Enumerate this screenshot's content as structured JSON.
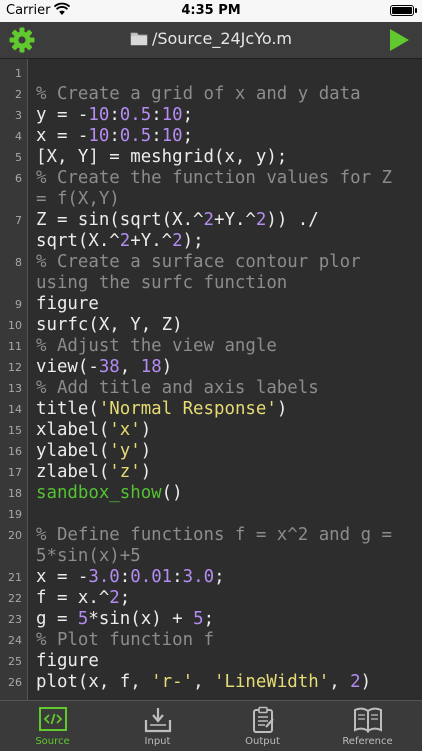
{
  "status_bar": {
    "carrier": "Carrier",
    "time": "4:35 PM"
  },
  "nav": {
    "title": "/Source_24JcYo.m",
    "left_icon": "gear-icon",
    "right_icon": "play-icon",
    "folder_icon": "folder-icon"
  },
  "editor": {
    "lines": [
      {
        "num": "1",
        "rows": 1,
        "tokens": []
      },
      {
        "num": "2",
        "rows": 1,
        "tokens": [
          {
            "t": "% Create a grid of x and y data",
            "k": "c"
          }
        ]
      },
      {
        "num": "3",
        "rows": 1,
        "tokens": [
          {
            "t": "y = -"
          },
          {
            "t": "10",
            "k": "n"
          },
          {
            "t": ":"
          },
          {
            "t": "0.5",
            "k": "n"
          },
          {
            "t": ":"
          },
          {
            "t": "10",
            "k": "n"
          },
          {
            "t": ";"
          }
        ]
      },
      {
        "num": "4",
        "rows": 1,
        "tokens": [
          {
            "t": "x = -"
          },
          {
            "t": "10",
            "k": "n"
          },
          {
            "t": ":"
          },
          {
            "t": "0.5",
            "k": "n"
          },
          {
            "t": ":"
          },
          {
            "t": "10",
            "k": "n"
          },
          {
            "t": ";"
          }
        ]
      },
      {
        "num": "5",
        "rows": 1,
        "tokens": [
          {
            "t": "[X, Y] = meshgrid(x, y);"
          }
        ]
      },
      {
        "num": "6",
        "rows": 2,
        "tokens": [
          {
            "t": "% Create the function values for Z\n= f(X,Y)",
            "k": "c"
          }
        ]
      },
      {
        "num": "7",
        "rows": 2,
        "tokens": [
          {
            "t": "Z = sin(sqrt(X.^"
          },
          {
            "t": "2",
            "k": "n"
          },
          {
            "t": "+Y.^"
          },
          {
            "t": "2",
            "k": "n"
          },
          {
            "t": ")) ./\nsqrt(X.^"
          },
          {
            "t": "2",
            "k": "n"
          },
          {
            "t": "+Y.^"
          },
          {
            "t": "2",
            "k": "n"
          },
          {
            "t": ");"
          }
        ]
      },
      {
        "num": "8",
        "rows": 2,
        "tokens": [
          {
            "t": "% Create a surface contour plor\nusing the surfc function",
            "k": "c"
          }
        ]
      },
      {
        "num": "9",
        "rows": 1,
        "tokens": [
          {
            "t": "figure"
          }
        ]
      },
      {
        "num": "10",
        "rows": 1,
        "tokens": [
          {
            "t": "surfc(X, Y, Z)"
          }
        ]
      },
      {
        "num": "11",
        "rows": 1,
        "tokens": [
          {
            "t": "% Adjust the view angle",
            "k": "c"
          }
        ]
      },
      {
        "num": "12",
        "rows": 1,
        "tokens": [
          {
            "t": "view(-"
          },
          {
            "t": "38",
            "k": "n"
          },
          {
            "t": ", "
          },
          {
            "t": "18",
            "k": "n"
          },
          {
            "t": ")"
          }
        ]
      },
      {
        "num": "13",
        "rows": 1,
        "tokens": [
          {
            "t": "% Add title and axis labels",
            "k": "c"
          }
        ]
      },
      {
        "num": "14",
        "rows": 1,
        "tokens": [
          {
            "t": "title("
          },
          {
            "t": "'Normal Response'",
            "k": "s"
          },
          {
            "t": ")"
          }
        ]
      },
      {
        "num": "15",
        "rows": 1,
        "tokens": [
          {
            "t": "xlabel("
          },
          {
            "t": "'x'",
            "k": "s"
          },
          {
            "t": ")"
          }
        ]
      },
      {
        "num": "16",
        "rows": 1,
        "tokens": [
          {
            "t": "ylabel("
          },
          {
            "t": "'y'",
            "k": "s"
          },
          {
            "t": ")"
          }
        ]
      },
      {
        "num": "17",
        "rows": 1,
        "tokens": [
          {
            "t": "zlabel("
          },
          {
            "t": "'z'",
            "k": "s"
          },
          {
            "t": ")"
          }
        ]
      },
      {
        "num": "18",
        "rows": 1,
        "tokens": [
          {
            "t": "sandbox_show",
            "k": "g"
          },
          {
            "t": "()"
          }
        ]
      },
      {
        "num": "19",
        "rows": 1,
        "tokens": []
      },
      {
        "num": "20",
        "rows": 2,
        "tokens": [
          {
            "t": "% Define functions f = x^2 and g =\n5*sin(x)+5",
            "k": "c"
          }
        ]
      },
      {
        "num": "21",
        "rows": 1,
        "tokens": [
          {
            "t": "x = -"
          },
          {
            "t": "3.0",
            "k": "n"
          },
          {
            "t": ":"
          },
          {
            "t": "0.01",
            "k": "n"
          },
          {
            "t": ":"
          },
          {
            "t": "3.0",
            "k": "n"
          },
          {
            "t": ";"
          }
        ]
      },
      {
        "num": "22",
        "rows": 1,
        "tokens": [
          {
            "t": "f = x.^"
          },
          {
            "t": "2",
            "k": "n"
          },
          {
            "t": ";"
          }
        ]
      },
      {
        "num": "23",
        "rows": 1,
        "tokens": [
          {
            "t": "g = "
          },
          {
            "t": "5",
            "k": "n"
          },
          {
            "t": "*sin(x) + "
          },
          {
            "t": "5",
            "k": "n"
          },
          {
            "t": ";"
          }
        ]
      },
      {
        "num": "24",
        "rows": 1,
        "tokens": [
          {
            "t": "% Plot function f",
            "k": "c"
          }
        ]
      },
      {
        "num": "25",
        "rows": 1,
        "tokens": [
          {
            "t": "figure"
          }
        ]
      },
      {
        "num": "26",
        "rows": 1,
        "tokens": [
          {
            "t": "plot(x, f, "
          },
          {
            "t": "'r-'",
            "k": "s"
          },
          {
            "t": ", "
          },
          {
            "t": "'LineWidth'",
            "k": "s"
          },
          {
            "t": ", "
          },
          {
            "t": "2",
            "k": "n"
          },
          {
            "t": ")"
          }
        ]
      }
    ]
  },
  "tabs": [
    {
      "label": "Source",
      "icon": "code-icon",
      "active": true
    },
    {
      "label": "Input",
      "icon": "download-tray-icon",
      "active": false
    },
    {
      "label": "Output",
      "icon": "clipboard-icon",
      "active": false
    },
    {
      "label": "Reference",
      "icon": "book-icon",
      "active": false
    }
  ],
  "colors": {
    "comment": "#8c8c8c",
    "number": "#b48cf2",
    "string": "#e6db74",
    "function": "#55c234",
    "accent": "#5fc92e",
    "background": "#2d2d2d"
  }
}
